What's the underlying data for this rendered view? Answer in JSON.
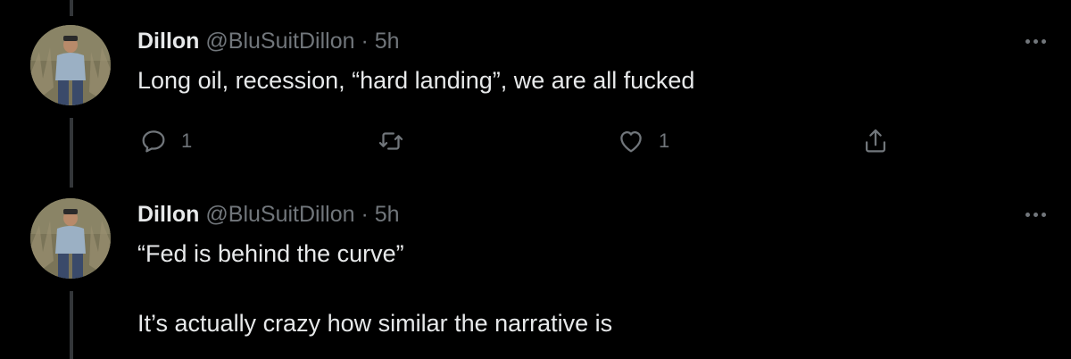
{
  "colors": {
    "background": "#000000",
    "text": "#e7e9ea",
    "muted": "#71767b",
    "thread_line": "#333639"
  },
  "tweets": [
    {
      "name": "Dillon",
      "handle": "@BluSuitDillon",
      "separator": "·",
      "time": "5h",
      "text": "Long oil, recession, “hard landing”, we are all fucked",
      "actions": {
        "reply_icon": "reply-icon",
        "reply_count": "1",
        "retweet_icon": "retweet-icon",
        "like_icon": "heart-icon",
        "like_count": "1",
        "share_icon": "share-icon"
      }
    },
    {
      "name": "Dillon",
      "handle": "@BluSuitDillon",
      "separator": "·",
      "time": "5h",
      "text_line1": "“Fed is behind the curve”",
      "text_line2": "It’s actually crazy how similar the narrative is"
    }
  ]
}
